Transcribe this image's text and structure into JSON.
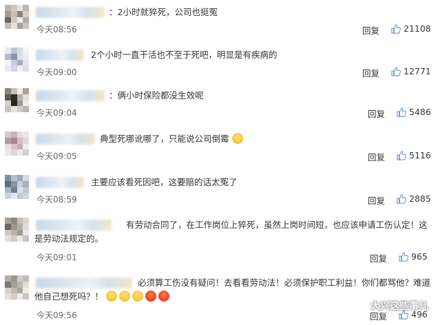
{
  "comments": [
    {
      "text": "2小时就猝死，公司也挺冤",
      "time": "今天08:56",
      "reply": "回复",
      "likes": "21108"
    },
    {
      "text": "2个小时一直干活也不至于死吧，明显是有疾病的",
      "time": "今天09:00",
      "reply": "回复",
      "likes": "12771"
    },
    {
      "text": "俩小时保险都没生效呢",
      "time": "今天09:04",
      "reply": "回复",
      "likes": "5486"
    },
    {
      "text": "典型死哪讹哪了，只能说公司倒霉",
      "time": "今天09:05",
      "reply": "回复",
      "likes": "5116"
    },
    {
      "text": "主要应该看死因吧，这要赔的话太冤了",
      "time": "今天08:59",
      "reply": "回复",
      "likes": "2885"
    },
    {
      "text": "有劳动合同了，在工作岗位上猝死，虽然上岗时间短，也应该申请工伤认定！这是劳动法规定的。",
      "time": "今天09:01",
      "reply": "回复",
      "likes": "965"
    },
    {
      "text": "必须算工伤没有疑问！去看看劳动法！必须保护职工利益！你们都骂他？难道他自己想死吗？！",
      "time": "今天09:56",
      "reply": "回复",
      "likes": "496"
    }
  ],
  "watermark": "大兴这些事儿",
  "colors": {
    "like_icon": "#7a9cc6",
    "accent_blur": "#dde8f1"
  },
  "icons": {
    "like": "thumbs-up-icon",
    "watermark": "wechat-icon"
  }
}
